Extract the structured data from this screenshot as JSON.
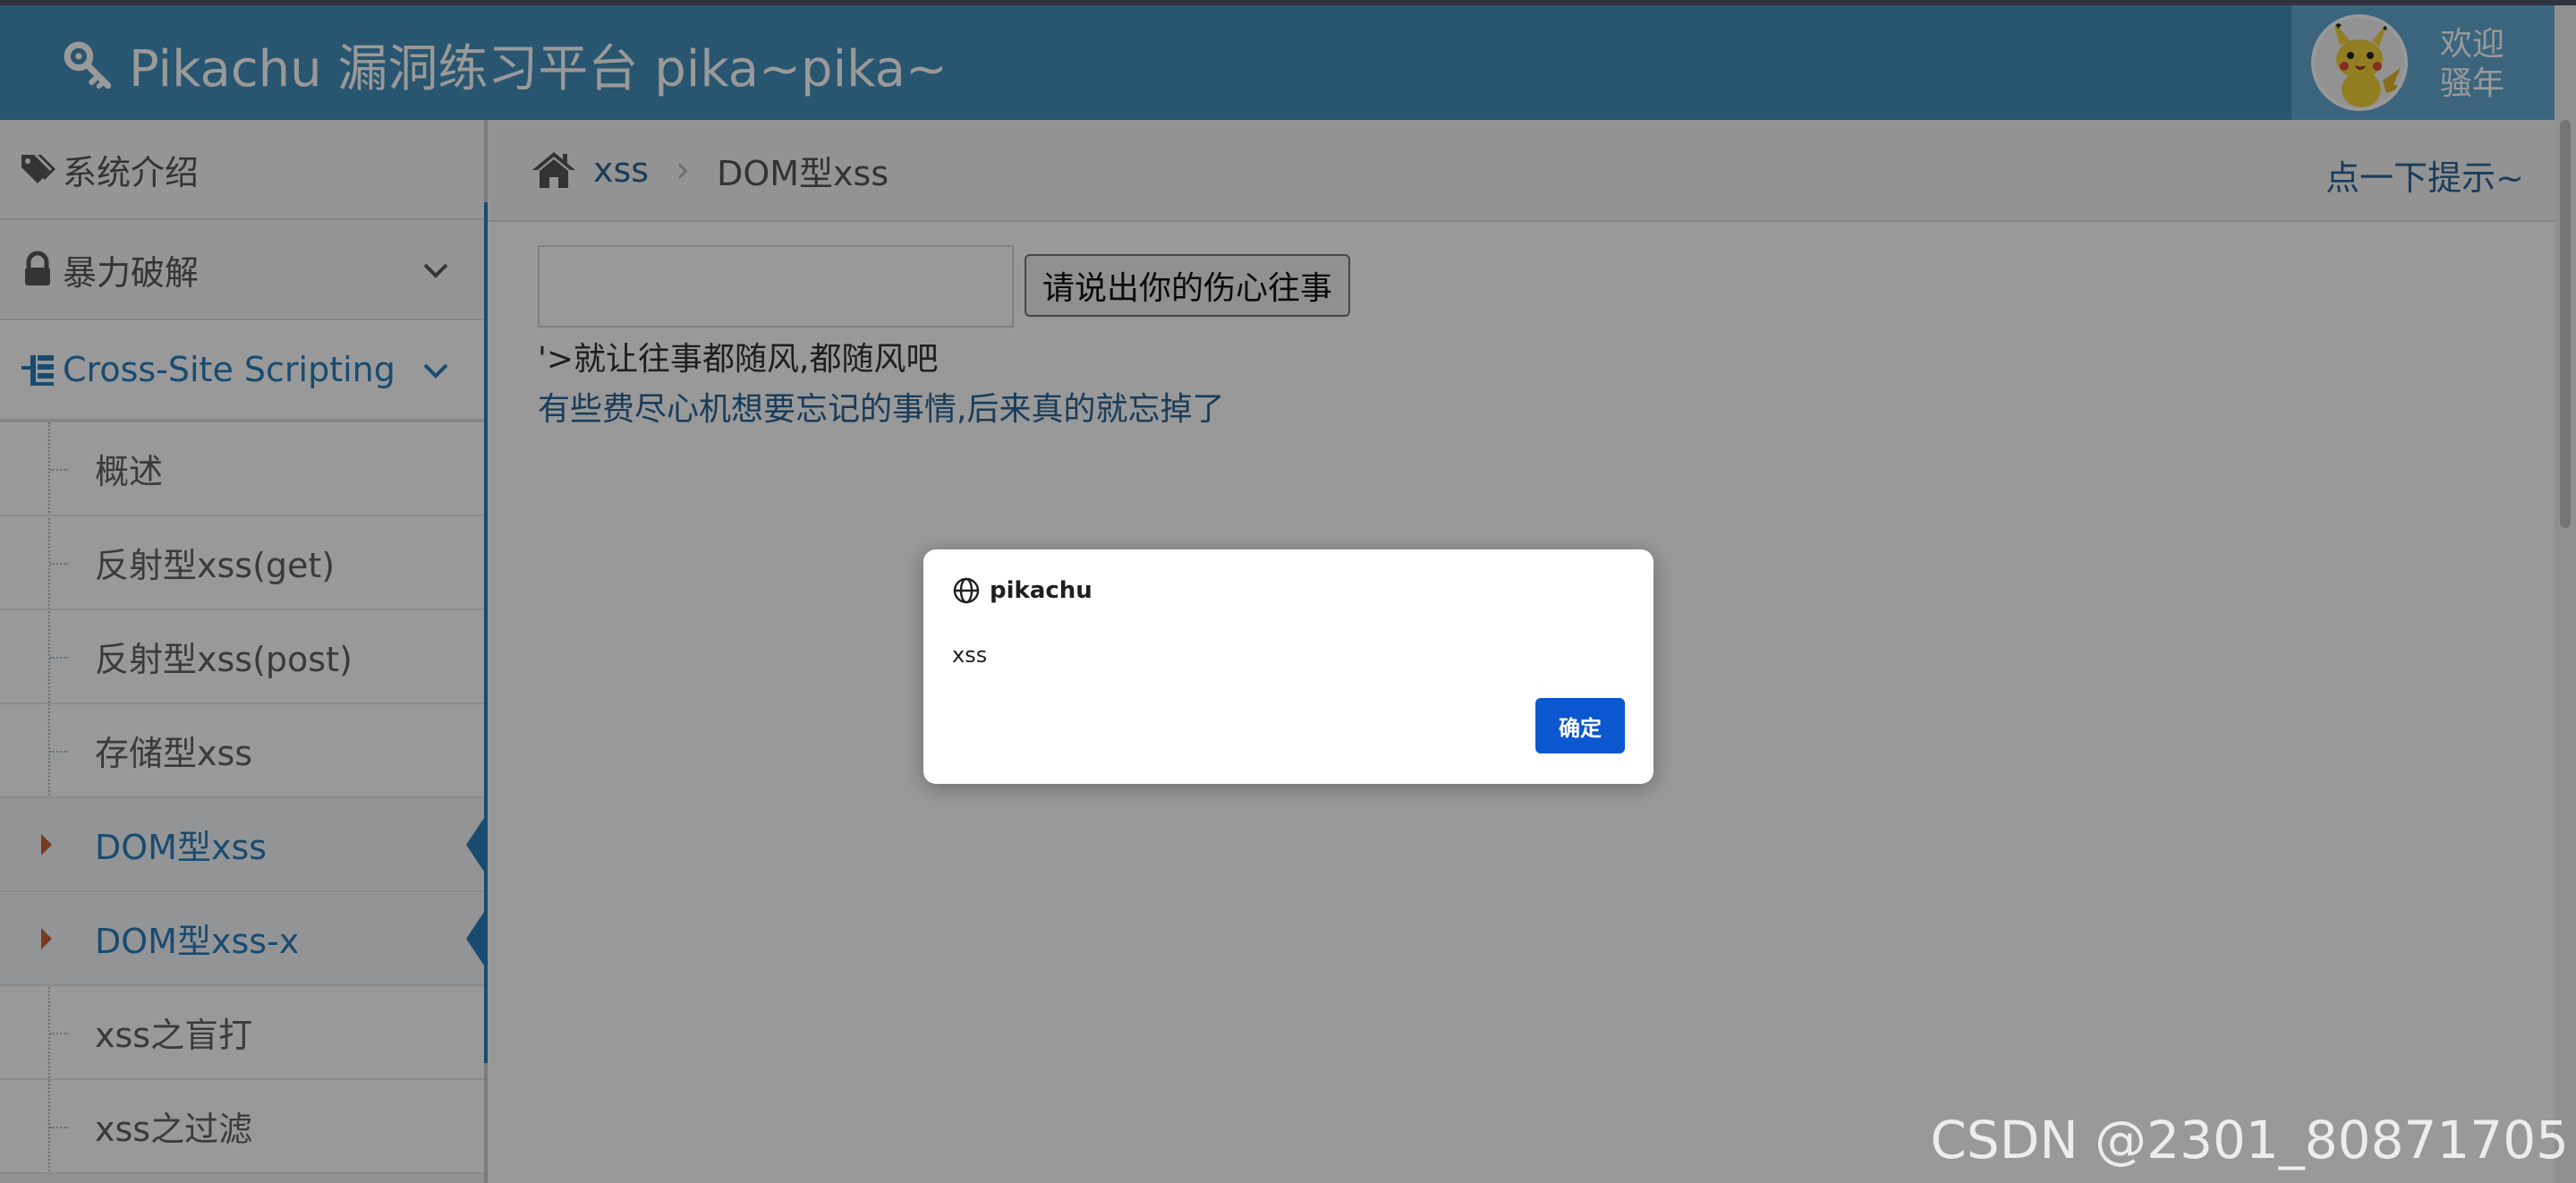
{
  "header": {
    "brand_title": "Pikachu 漏洞练习平台 pika~pika~",
    "brand_icon": "key-icon",
    "welcome_line1": "欢迎",
    "welcome_line2": "骚年"
  },
  "sidebar": {
    "items": [
      {
        "label": "系统介绍",
        "icon": "tags-icon"
      },
      {
        "label": "暴力破解",
        "icon": "lock-icon"
      },
      {
        "label": "Cross-Site Scripting",
        "icon": "sitemap-icon"
      }
    ],
    "xss_submenu": [
      {
        "label": "概述"
      },
      {
        "label": "反射型xss(get)"
      },
      {
        "label": "反射型xss(post)"
      },
      {
        "label": "存储型xss"
      },
      {
        "label": "DOM型xss"
      },
      {
        "label": "DOM型xss-x"
      },
      {
        "label": "xss之盲打"
      },
      {
        "label": "xss之过滤"
      }
    ]
  },
  "breadcrumb": {
    "home_icon": "home-icon",
    "link": "xss",
    "separator": "›",
    "current": "DOM型xss"
  },
  "hint": "点一下提示~",
  "form": {
    "input_value": "",
    "submit_label": "请说出你的伤心往事"
  },
  "result": {
    "text": "'>就让往事都随风,都随风吧",
    "link": "有些费尽心机想要忘记的事情,后来真的就忘掉了"
  },
  "alert": {
    "origin": "pikachu",
    "message": "xss",
    "ok_label": "确定"
  },
  "watermark": "CSDN @2301_80871705",
  "colors": {
    "header_bg": "#438eb9",
    "accent": "#2b7dbc",
    "link": "#2a6496",
    "alert_button": "#0b57d0"
  }
}
